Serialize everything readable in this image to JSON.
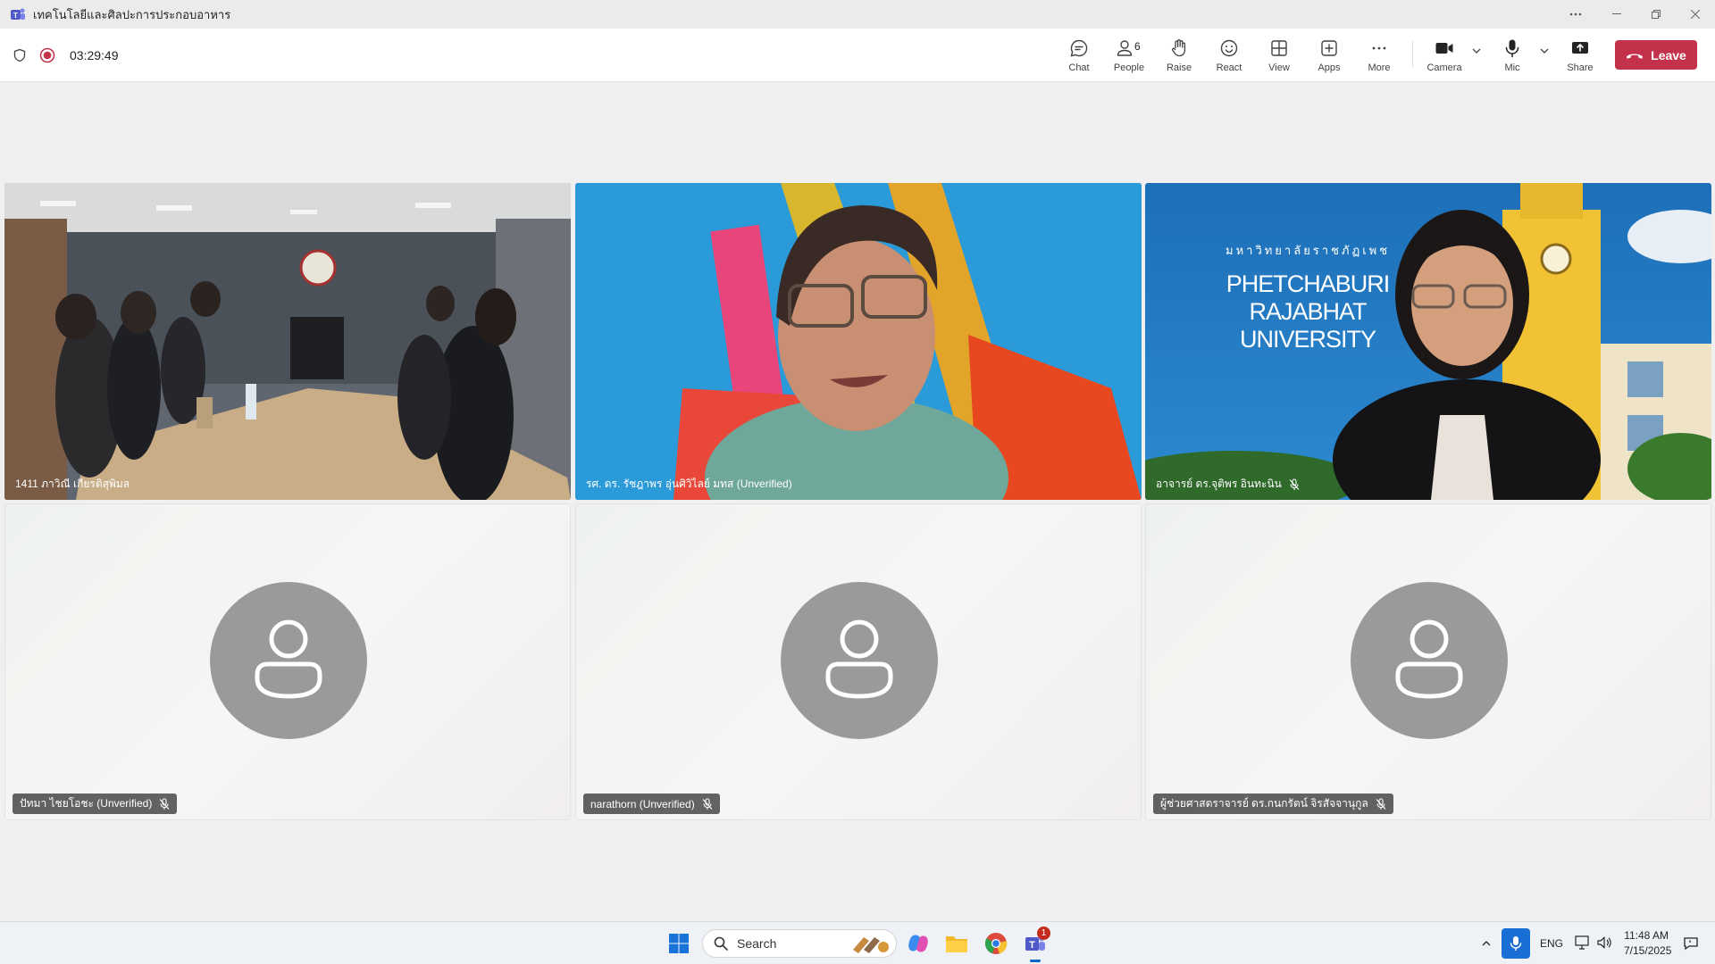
{
  "window": {
    "title": "เทคโนโลยีและศิลปะการประกอบอาหาร",
    "controls": [
      "more",
      "minimize",
      "restore",
      "close"
    ]
  },
  "meeting": {
    "timer": "03:29:49",
    "toolbar": {
      "chat": "Chat",
      "people": "People",
      "people_count": "6",
      "raise": "Raise",
      "react": "React",
      "view": "View",
      "apps": "Apps",
      "more": "More",
      "camera": "Camera",
      "mic": "Mic",
      "share": "Share",
      "leave": "Leave"
    },
    "colors": {
      "leave": "#c4314b",
      "active_speaker": "#5b5fc7",
      "recording": "#c4314b"
    }
  },
  "participants": [
    {
      "name": "1411 ภาวิณี เกียรติสุพิมล",
      "video": true,
      "muted": false
    },
    {
      "name": "รศ. ดร. รัชฎาพร อุ่นศิวิไลย์ มทส (Unverified)",
      "video": true,
      "muted": false,
      "active": true
    },
    {
      "name": "อาจารย์ ดร.จุติพร อินทะนิน",
      "video": true,
      "muted": true
    },
    {
      "name": "ปัทมา ไชยโอชะ (Unverified)",
      "video": false,
      "muted": true
    },
    {
      "name": "narathorn (Unverified)",
      "video": false,
      "muted": true
    },
    {
      "name": "ผู้ช่วยศาสตราจารย์ ดร.กนกรัตน์ จิรสัจจานุกูล",
      "video": false,
      "muted": true
    }
  ],
  "backdrop_text": {
    "thai": "มหาวิทยาลัยราชภัฏเพช",
    "line1": "PHETCHABURI",
    "line2": "RAJABHAT",
    "line3": "UNIVERSITY"
  },
  "taskbar": {
    "search_placeholder": "Search",
    "language": "ENG",
    "time": "11:48 AM",
    "date": "7/15/2025",
    "teams_badge": "1"
  }
}
